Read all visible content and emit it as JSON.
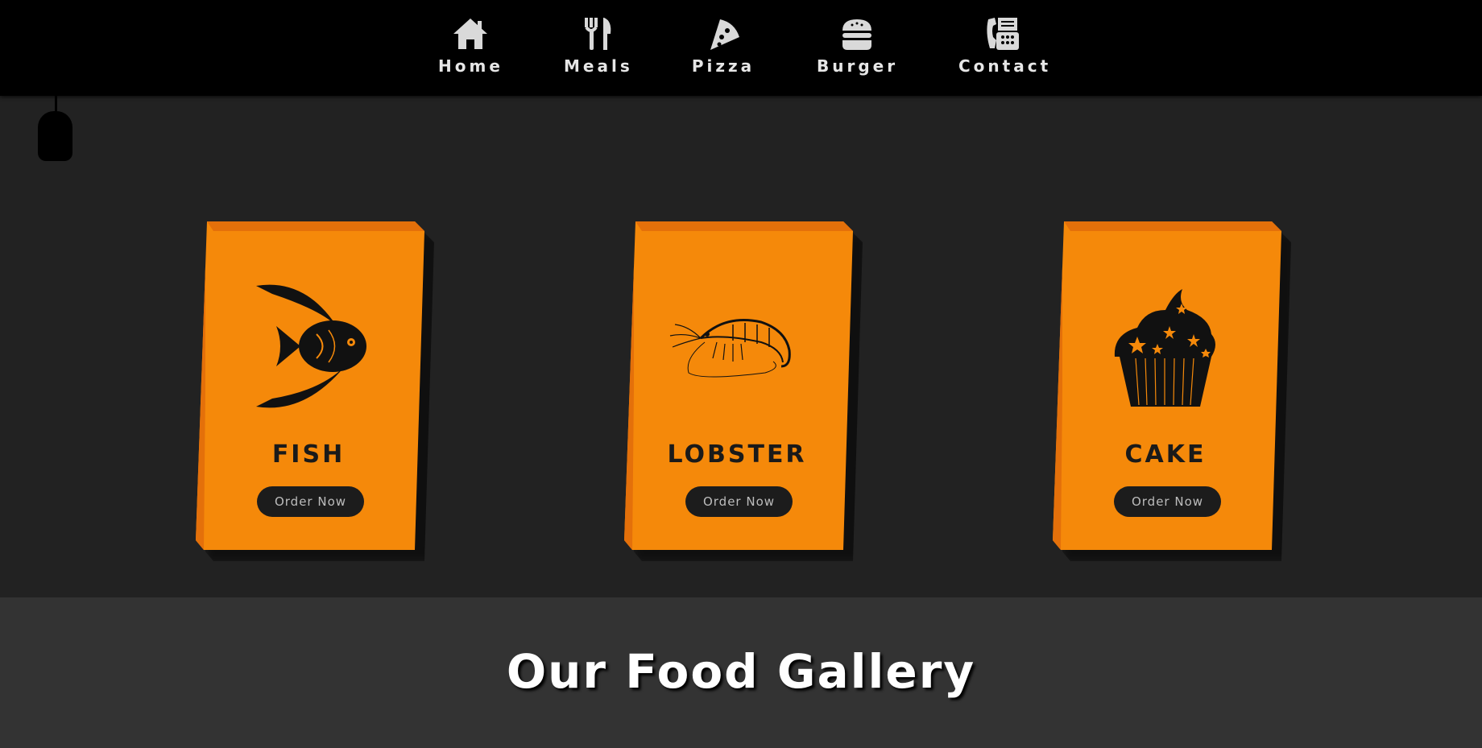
{
  "nav": {
    "items": [
      {
        "label": "Home",
        "icon": "home-icon"
      },
      {
        "label": "Meals",
        "icon": "utensils-icon"
      },
      {
        "label": "Pizza",
        "icon": "pizza-slice-icon"
      },
      {
        "label": "Burger",
        "icon": "burger-icon"
      },
      {
        "label": "Contact",
        "icon": "phone-fax-icon"
      }
    ]
  },
  "cards": [
    {
      "title": "FISH",
      "button": "Order Now",
      "image": "fish-illustration"
    },
    {
      "title": "LOBSTER",
      "button": "Order Now",
      "image": "shrimp-illustration"
    },
    {
      "title": "CAKE",
      "button": "Order Now",
      "image": "cupcake-illustration"
    }
  ],
  "gallery": {
    "title": "Our Food Gallery"
  },
  "colors": {
    "nav_bg": "#000000",
    "page_bg": "#222222",
    "card_bg": "#f5890a",
    "card_edge": "#e4700a",
    "button_bg": "#1c1c1c",
    "gallery_bg": "#333333"
  }
}
